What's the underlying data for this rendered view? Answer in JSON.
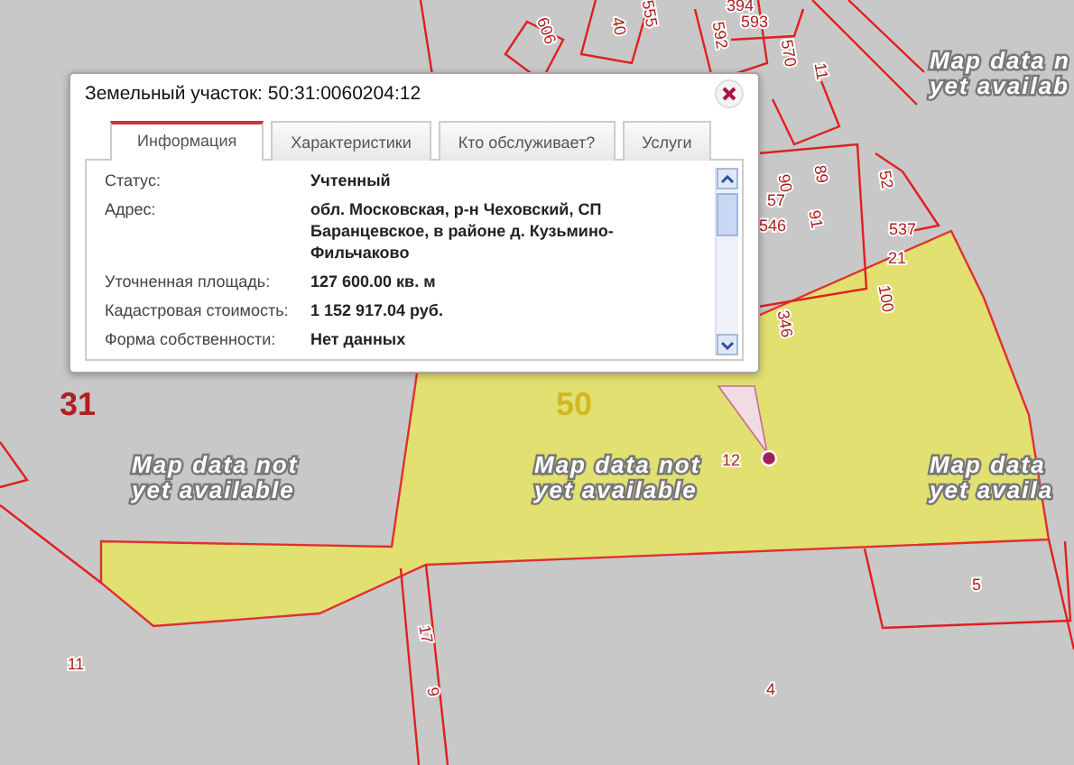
{
  "map": {
    "notices": [
      {
        "lines": [
          "Map data n",
          "yet availab"
        ]
      },
      {
        "lines": [
          "Map data not",
          "yet available"
        ]
      },
      {
        "lines": [
          "Map data not",
          "yet available"
        ]
      },
      {
        "lines": [
          "Map data",
          "yet availa"
        ]
      }
    ],
    "plot_numbers": [
      "606",
      "40",
      "555",
      "394",
      "592",
      "593",
      "570",
      "11",
      "52",
      "89",
      "90",
      "57",
      "91",
      "546",
      "537",
      "21",
      "100",
      "346",
      "31",
      "50",
      "12",
      "11",
      "17",
      "9",
      "4",
      "5"
    ]
  },
  "popup": {
    "title": "Земельный участок: 50:31:0060204:12",
    "tabs": [
      {
        "label": "Информация",
        "selected": true
      },
      {
        "label": "Характеристики",
        "selected": false
      },
      {
        "label": "Кто обслуживает?",
        "selected": false
      },
      {
        "label": "Услуги",
        "selected": false
      }
    ],
    "rows": [
      {
        "label": "Статус:",
        "value": "Учтенный"
      },
      {
        "label": "Адрес:",
        "value": "обл. Московская, р-н Чеховский, СП Баранцевское, в районе д. Кузьмино-Фильчаково"
      },
      {
        "label": "Уточненная площадь:",
        "value": "127 600.00 кв. м"
      },
      {
        "label": "Кадастровая стоимость:",
        "value": "1 152 917.04 руб."
      },
      {
        "label": "Форма собственности:",
        "value": "Нет данных"
      }
    ]
  }
}
